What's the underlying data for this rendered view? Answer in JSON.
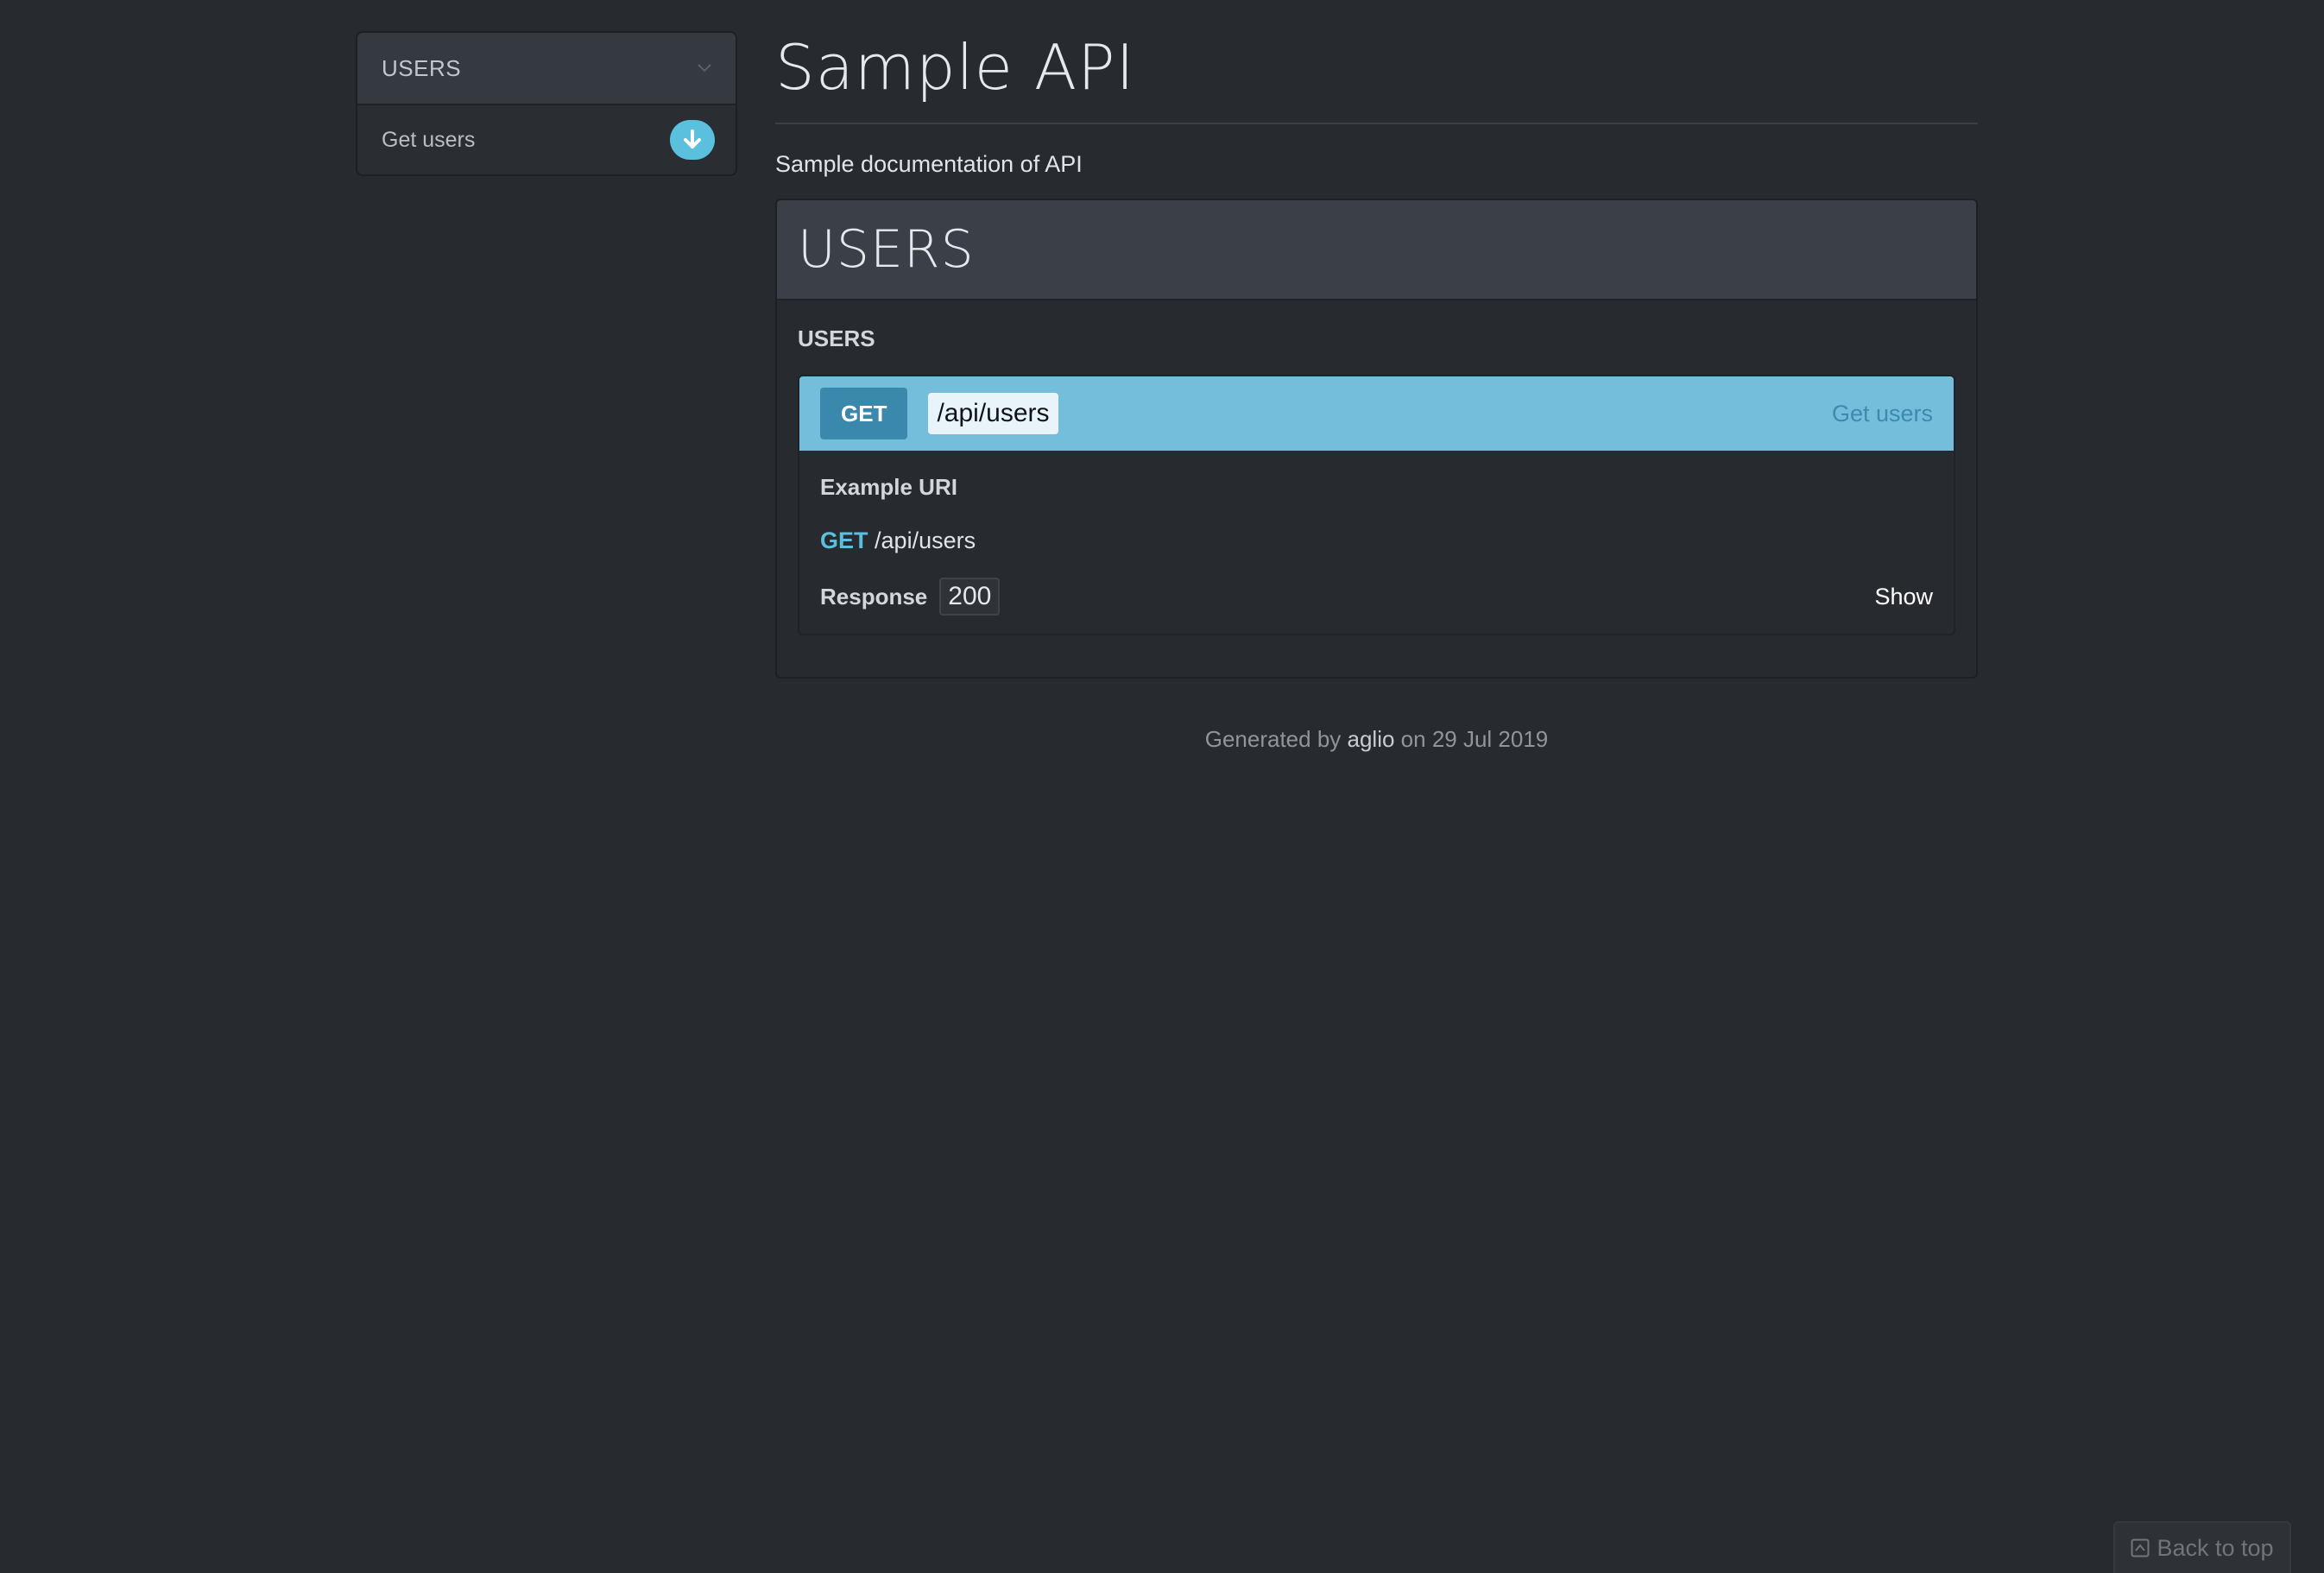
{
  "nav": {
    "group_title": "USERS",
    "items": [
      {
        "label": "Get users"
      }
    ]
  },
  "main": {
    "title": "Sample API",
    "description": "Sample documentation of API",
    "group": {
      "title": "USERS",
      "resource_title": "USERS",
      "action": {
        "method": "GET",
        "uri": "/api/users",
        "name": "Get users",
        "example_label": "Example URI",
        "example_method": "GET",
        "example_uri": "/api/users",
        "response_label": "Response",
        "response_code": "200",
        "show_label": "Show"
      }
    }
  },
  "footer": {
    "prefix": "Generated by ",
    "tool": "aglio",
    "suffix": " on 29 Jul 2019"
  },
  "back_to_top": {
    "label": "Back to top"
  },
  "colors": {
    "background": "#272b30",
    "accent": "#5bc0de",
    "action_header": "#74bedc",
    "method_badge": "#3b88ad"
  },
  "icons": {
    "nav_group_toggle": "chevron-down-icon",
    "nav_item_badge": "arrow-down-circle-icon",
    "back_to_top": "arrow-up-square-icon"
  }
}
